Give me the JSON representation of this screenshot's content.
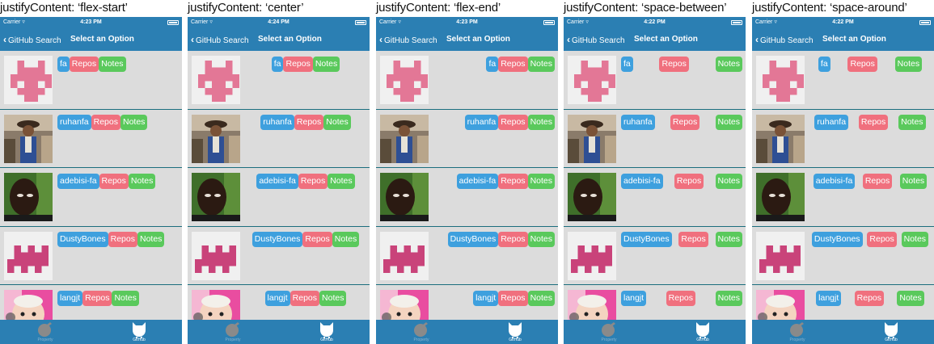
{
  "colors": {
    "nav": "#2b7fb3",
    "user": "#3ea0de",
    "repos": "#f0707e",
    "notes": "#5ac95c",
    "divider": "#1b6e7e",
    "bg": "#dcdcdc"
  },
  "panels": [
    {
      "caption": "justifyContent: ‘flex-start’",
      "justify": "flex-start",
      "time": "4:23 PM"
    },
    {
      "caption": "justifyContent: ‘center’",
      "justify": "center",
      "time": "4:24 PM"
    },
    {
      "caption": "justifyContent: ‘flex-end’",
      "justify": "flex-end",
      "time": "4:23 PM"
    },
    {
      "caption": "justifyContent: ‘space-between’",
      "justify": "space-between",
      "time": "4:22 PM"
    },
    {
      "caption": "justifyContent: ‘space-around’",
      "justify": "space-around",
      "time": "4:22 PM"
    }
  ],
  "statusbar": {
    "carrier": "Carrier ▿"
  },
  "navbar": {
    "back_label": "GitHub Search",
    "title": "Select an Option",
    "back_icon": "chevron-left-icon"
  },
  "users": [
    {
      "name": "fa",
      "avatar": "identicon-skull"
    },
    {
      "name": "ruhanfa",
      "avatar": "photo-pirate"
    },
    {
      "name": "adebisi-fa",
      "avatar": "photo-man"
    },
    {
      "name": "DustyBones",
      "avatar": "identicon-crown"
    },
    {
      "name": "langjt",
      "avatar": "photo-baby"
    }
  ],
  "buttons": {
    "repos": "Repos",
    "notes": "Notes"
  },
  "tabbar": {
    "tab1_label": "Property",
    "tab1_icon": "ball-icon",
    "tab2_label": "GitHub",
    "tab2_icon": "octocat-icon"
  }
}
